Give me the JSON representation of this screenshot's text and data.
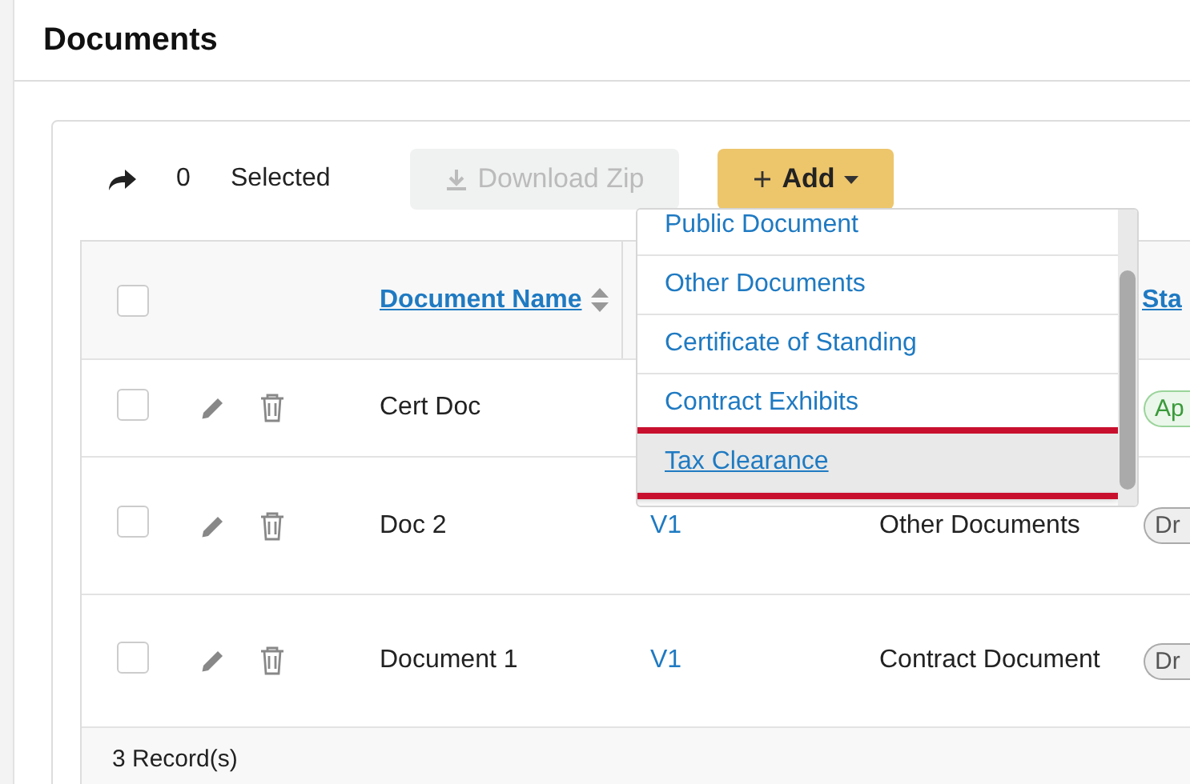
{
  "page": {
    "title": "Documents"
  },
  "toolbar": {
    "selected_count": "0",
    "selected_label": "Selected",
    "download_button": {
      "label": "Download Zip",
      "disabled": true
    },
    "add_button": {
      "label": "Add"
    }
  },
  "table": {
    "select_all_checked": false,
    "columns": [
      {
        "label": "Document Name",
        "sortable": true
      },
      {
        "label": "Sta"
      }
    ],
    "rows": [
      {
        "checked": false,
        "name": "Cert Doc",
        "version": "",
        "type": "",
        "status": {
          "label": "Ap",
          "kind": "approved"
        }
      },
      {
        "checked": false,
        "name": "Doc 2",
        "version": "V1",
        "type": "Other Documents",
        "status": {
          "label": "Dr",
          "kind": "draft"
        }
      },
      {
        "checked": false,
        "name": "Document 1",
        "version": "V1",
        "type": "Contract Document",
        "status": {
          "label": "Dr",
          "kind": "draft"
        }
      }
    ],
    "footer": "3 Record(s)"
  },
  "add_menu": {
    "items": [
      {
        "label": "Public Document",
        "highlighted": false
      },
      {
        "label": "Other Documents",
        "highlighted": false
      },
      {
        "label": "Certificate of Standing",
        "highlighted": false
      },
      {
        "label": "Contract Exhibits",
        "highlighted": false
      },
      {
        "label": "Tax Clearance",
        "highlighted": true
      }
    ]
  }
}
